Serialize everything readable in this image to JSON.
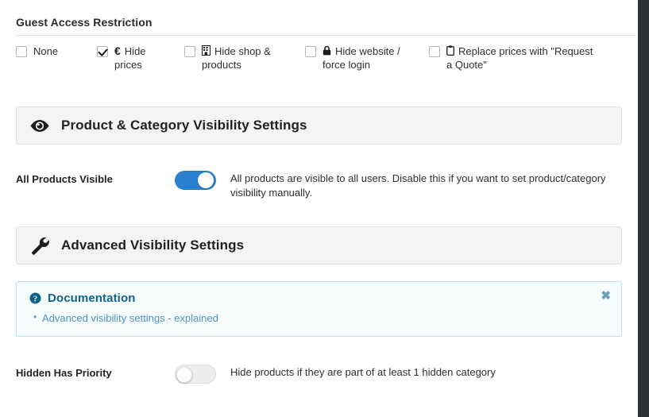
{
  "guest_access": {
    "title": "Guest Access Restriction",
    "options": [
      {
        "label": "None",
        "icon": "none",
        "checked": false,
        "name": "guest-access-none"
      },
      {
        "label": "Hide prices",
        "icon": "euro-icon",
        "checked": true,
        "name": "guest-access-hide-prices"
      },
      {
        "label": "Hide shop & products",
        "icon": "shop-icon",
        "checked": false,
        "name": "guest-access-hide-shop-products"
      },
      {
        "label": "Hide website / force login",
        "icon": "lock-icon",
        "checked": false,
        "name": "guest-access-hide-website-force-login"
      },
      {
        "label": "Replace prices with \"Request a Quote\"",
        "icon": "clipboard-icon",
        "checked": false,
        "name": "guest-access-replace-prices-request-quote"
      }
    ]
  },
  "product_category_section": {
    "icon": "eye-icon",
    "title": "Product & Category Visibility Settings"
  },
  "all_products_visible": {
    "label": "All Products Visible",
    "toggle_state": "on",
    "description": "All products are visible to all users. Disable this if you want to set product/category visibility manually."
  },
  "advanced_section": {
    "icon": "wrench-icon",
    "title": "Advanced Visibility Settings"
  },
  "documentation": {
    "icon": "question-circle-icon",
    "title": "Documentation",
    "close_label": "✖",
    "links": [
      {
        "label": "Advanced visibility settings - explained"
      }
    ]
  },
  "hidden_has_priority": {
    "label": "Hidden Has Priority",
    "toggle_state": "off",
    "description": "Hide products if they are part of at least 1 hidden category"
  },
  "colors": {
    "toggle_on": "#2a80cf",
    "panel_bg": "#f3f4f5",
    "doc_bg": "#f7fdfd",
    "doc_border": "#bfe2e5",
    "doc_title": "#126287",
    "doc_link": "#5091c2",
    "gutter": "#2e3134"
  }
}
